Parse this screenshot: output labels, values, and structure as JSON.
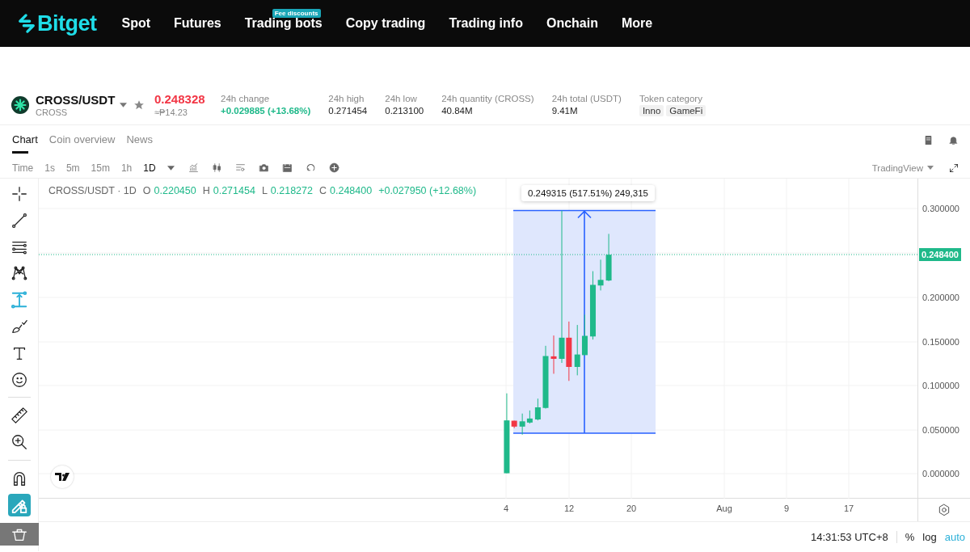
{
  "nav": {
    "logo": "Bitget",
    "items": [
      {
        "label": "Spot"
      },
      {
        "label": "Futures"
      },
      {
        "label": "Trading bots",
        "badge": "Fee discounts"
      },
      {
        "label": "Copy trading"
      },
      {
        "label": "Trading info"
      },
      {
        "label": "Onchain"
      },
      {
        "label": "More"
      }
    ]
  },
  "ticker": {
    "pair": "CROSS/USDT",
    "base": "CROSS",
    "price": "0.248328",
    "fiat": "≈₱14.23",
    "stats": [
      {
        "label": "24h change",
        "value": "+0.029885 (+13.68%)",
        "kind": "up"
      },
      {
        "label": "24h high",
        "value": "0.271454",
        "kind": "plain"
      },
      {
        "label": "24h low",
        "value": "0.213100",
        "kind": "plain"
      },
      {
        "label": "24h quantity (CROSS)",
        "value": "40.84M",
        "kind": "plain"
      },
      {
        "label": "24h total (USDT)",
        "value": "9.41M",
        "kind": "plain"
      }
    ],
    "category": {
      "label": "Token category",
      "tags": [
        "Inno",
        "GameFi"
      ]
    }
  },
  "tabs": [
    {
      "label": "Chart",
      "selected": true
    },
    {
      "label": "Coin overview",
      "selected": false
    },
    {
      "label": "News",
      "selected": false
    }
  ],
  "intervals": [
    {
      "label": "Time",
      "selected": false
    },
    {
      "label": "1s",
      "selected": false
    },
    {
      "label": "5m",
      "selected": false
    },
    {
      "label": "15m",
      "selected": false
    },
    {
      "label": "1h",
      "selected": false
    },
    {
      "label": "1D",
      "selected": true
    }
  ],
  "chart_source": "TradingView",
  "tools": [
    {
      "kind": "crosshair",
      "selected": false
    },
    {
      "kind": "trend",
      "selected": false
    },
    {
      "kind": "fib",
      "selected": false
    },
    {
      "kind": "pattern",
      "selected": false
    },
    {
      "kind": "measure",
      "selected": true
    },
    {
      "kind": "brush",
      "selected": false
    },
    {
      "kind": "text",
      "selected": false
    },
    {
      "kind": "emoji",
      "selected": false
    },
    {
      "kind": "divider"
    },
    {
      "kind": "ruler",
      "selected": false
    },
    {
      "kind": "zoom",
      "selected": false
    },
    {
      "kind": "divider"
    },
    {
      "kind": "magnet",
      "selected": false
    },
    {
      "kind": "lock",
      "selected": true
    },
    {
      "kind": "trash",
      "selected": false
    }
  ],
  "legend": {
    "title": "CROSS/USDT · 1D",
    "values": [
      {
        "key": "O",
        "value": "0.220450"
      },
      {
        "key": "H",
        "value": "0.271454"
      },
      {
        "key": "L",
        "value": "0.218272"
      },
      {
        "key": "C",
        "value": "0.248400"
      }
    ],
    "change": "+0.027950 (+12.68%)"
  },
  "measure_tooltip": "0.249315 (517.51%) 249,315",
  "price_axis": [
    "0.300000",
    "0.200000",
    "0.150000",
    "0.100000",
    "0.050000",
    "0.000000"
  ],
  "current_price": "0.248400",
  "time_axis": [
    "4",
    "12",
    "20",
    "Aug",
    "9",
    "17"
  ],
  "status": {
    "time": "14:31:53 UTC+8",
    "scales": [
      {
        "label": "%",
        "selected": false
      },
      {
        "label": "log",
        "selected": false
      },
      {
        "label": "auto",
        "selected": true
      }
    ]
  }
}
